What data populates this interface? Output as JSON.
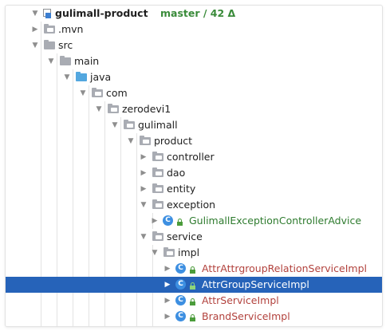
{
  "project": {
    "name": "gulimall-product",
    "branch_info": "master / 42 Δ"
  },
  "tree": [
    {
      "label": ".mvn",
      "type": "folder",
      "arrow": "▶"
    },
    {
      "label": "src",
      "type": "folder",
      "arrow": "▼"
    },
    {
      "label": "main",
      "type": "folder",
      "arrow": "▼"
    },
    {
      "label": "java",
      "type": "source-folder",
      "arrow": "▼"
    },
    {
      "label": "com",
      "type": "package",
      "arrow": "▼"
    },
    {
      "label": "zerodevi1",
      "type": "package",
      "arrow": "▼"
    },
    {
      "label": "gulimall",
      "type": "package",
      "arrow": "▼"
    },
    {
      "label": "product",
      "type": "package",
      "arrow": "▼"
    },
    {
      "label": "controller",
      "type": "package",
      "arrow": "▶"
    },
    {
      "label": "dao",
      "type": "package",
      "arrow": "▶"
    },
    {
      "label": "entity",
      "type": "package",
      "arrow": "▶"
    },
    {
      "label": "exception",
      "type": "package",
      "arrow": "▼"
    },
    {
      "label": "GulimallExceptionControllerAdvice",
      "type": "class",
      "arrow": "▶"
    },
    {
      "label": "service",
      "type": "package",
      "arrow": "▼"
    },
    {
      "label": "impl",
      "type": "package",
      "arrow": "▼"
    },
    {
      "label": "AttrAttrgroupRelationServiceImpl",
      "type": "class",
      "arrow": "▶"
    },
    {
      "label": "AttrGroupServiceImpl",
      "type": "class",
      "arrow": "▶"
    },
    {
      "label": "AttrServiceImpl",
      "type": "class",
      "arrow": "▶"
    },
    {
      "label": "BrandServiceImpl",
      "type": "class",
      "arrow": "▶"
    }
  ],
  "selected": "AttrGroupServiceImpl",
  "colors": {
    "selection": "#2663b9",
    "vcs_green": "#3a8b3a",
    "file_added": "#2e7b2e",
    "file_modified": "#b2423d",
    "class_icon": "#3d8fe1",
    "folder": "#a9acb3",
    "source_folder": "#53a7df"
  },
  "icons": {
    "module": "module-icon",
    "folder": "folder-icon",
    "source_folder": "source-folder-icon",
    "class": "class-c-icon",
    "lock": "lock-icon",
    "expand": "chevron-right-icon",
    "collapse": "chevron-down-icon"
  },
  "class_icon_letter": "C"
}
